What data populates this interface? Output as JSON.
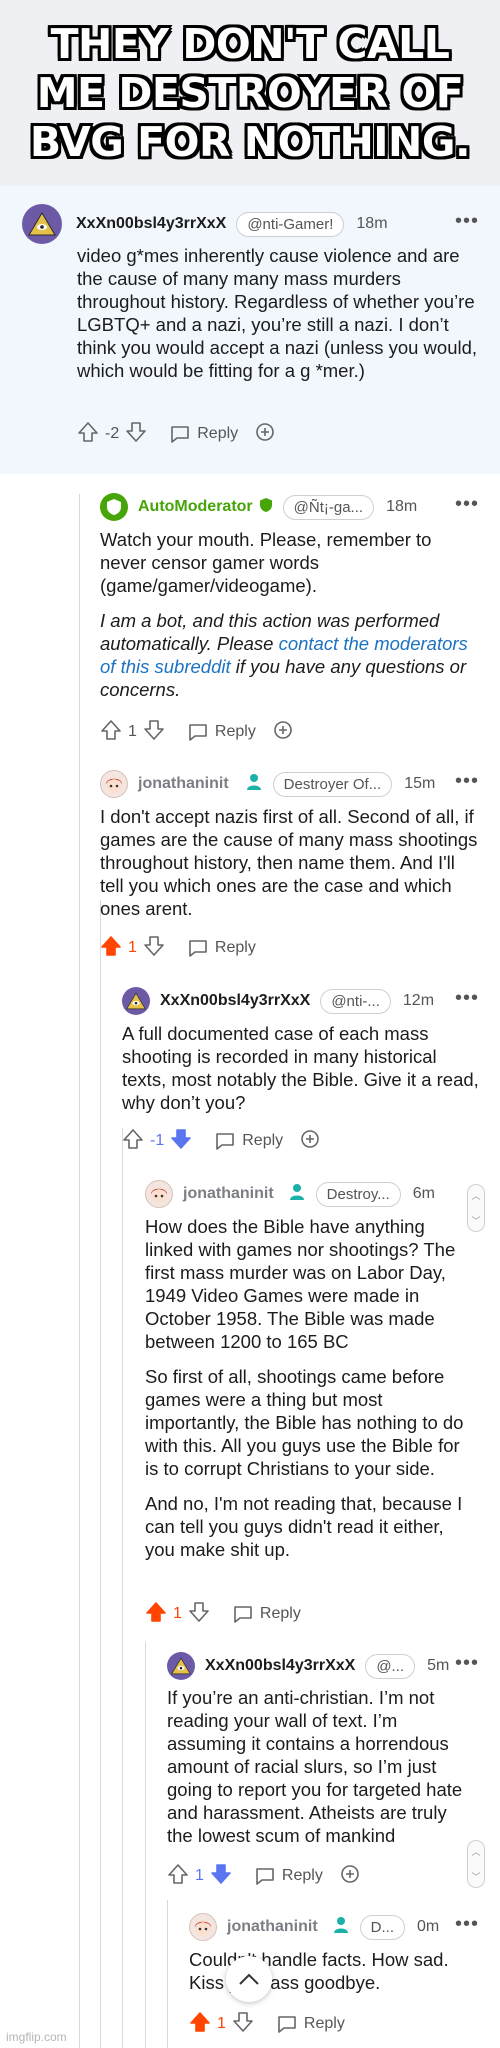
{
  "meme": {
    "caption": "THEY DON'T CALL ME DESTROYER OF BVG FOR NOTHING."
  },
  "colors": {
    "upvote": "#ff4500",
    "downvote": "#5a75f0",
    "mod_green": "#46a508",
    "link": "#1d72c2",
    "header_bg": "#eef0f3",
    "highlight_bg": "#f1f7fd"
  },
  "comments": [
    {
      "username": "XxXn00bsl4y3rrXxX",
      "flair": "@nti-Gamer!",
      "time": "18m",
      "avatar_icon": "triangle-eye-icon",
      "body": [
        "video g*mes inherently cause violence and are the cause of many many mass murders throughout history. Regardless of whether you’re LGBTQ+ and a nazi, you’re still a nazi. I don’t think you would accept a nazi (unless you would, which would be fitting for a g *mer.)"
      ],
      "votes": "-2",
      "reply_label": "Reply"
    },
    {
      "username": "AutoModerator",
      "flair": "@Ñt¡-ga...",
      "time": "18m",
      "avatar_icon": "shield-icon",
      "body1": "Watch your mouth. Please, remember to never censor gamer words (game/gamer/videogame).",
      "bot_pre": "I am a bot, and this action was performed automatically. Please ",
      "bot_link": "contact the moderators of this subreddit",
      "bot_post": " if you have any questions or concerns.",
      "votes": "1",
      "reply_label": "Reply"
    },
    {
      "username": "jonathaninit",
      "flair": "Destroyer Of...",
      "time": "15m",
      "avatar_icon": "anime-girl-icon",
      "body": [
        "I don't accept nazis first of all. Second of all, if games are the cause of many mass shootings throughout history, then name them. And I'll tell you which ones are the case and which ones arent."
      ],
      "votes": "1",
      "reply_label": "Reply"
    },
    {
      "username": "XxXn00bsl4y3rrXxX",
      "flair": "@nti-...",
      "time": "12m",
      "avatar_icon": "triangle-eye-icon",
      "body": [
        "A full documented case of each mass shooting is recorded in many historical texts, most notably the Bible. Give it a read, why don’t you?"
      ],
      "votes": "-1",
      "reply_label": "Reply"
    },
    {
      "username": "jonathaninit",
      "flair": "Destroy...",
      "time": "6m",
      "avatar_icon": "anime-girl-icon",
      "body": [
        "How does the Bible have anything linked with games nor shootings? The first mass murder was on Labor Day, 1949 Video Games were made in October 1958. The Bible was made between 1200 to 165 BC",
        "So first of all, shootings came before games were a thing but most importantly, the Bible has nothing to do with this. All you guys use the Bible for is to corrupt Christians to your side.",
        "And no, I'm not reading that, because I can tell you guys didn't read it either, you make shit up."
      ],
      "votes": "1",
      "reply_label": "Reply"
    },
    {
      "username": "XxXn00bsl4y3rrXxX",
      "flair": "@...",
      "time": "5m",
      "avatar_icon": "triangle-eye-icon",
      "body": [
        "If you’re an anti-christian. I’m not reading your wall of text. I’m assuming it contains a horrendous amount of racial slurs, so I’m just going to report you for targeted hate and harassment. Atheists are truly the lowest scum of mankind"
      ],
      "votes": "1",
      "reply_label": "Reply"
    },
    {
      "username": "jonathaninit",
      "flair": "D...",
      "time": "0m",
      "avatar_icon": "anime-girl-icon",
      "body": [
        "Couldn't handle facts. How sad. Kiss your ass goodbye."
      ],
      "votes": "1",
      "reply_label": "Reply"
    }
  ],
  "watermark": "imgflip.com"
}
